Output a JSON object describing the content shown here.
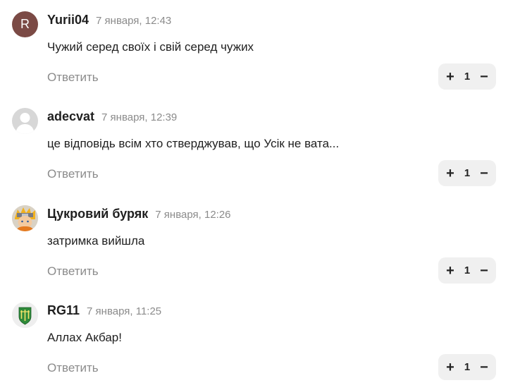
{
  "comments": [
    {
      "author": "Yurii04",
      "avatar_letter": "R",
      "avatar_color": "#7b4a45",
      "date": "7 января, 12:43",
      "text": "Чужий серед своїх і свій серед чужих",
      "reply_label": "Ответить",
      "vote_count": "1"
    },
    {
      "author": "adecvat",
      "avatar_icon": "default-user-icon",
      "date": "7 января, 12:39",
      "text": "це відповідь всім хто стверджував, що Усік не вата...",
      "reply_label": "Ответить",
      "vote_count": "1"
    },
    {
      "author": "Цукровий буряк",
      "avatar_icon": "anime-character-avatar",
      "date": "7 января, 12:26",
      "text": "затримка вийшла",
      "reply_label": "Ответить",
      "vote_count": "1"
    },
    {
      "author": "RG11",
      "avatar_icon": "green-emblem-avatar",
      "date": "7 января, 11:25",
      "text": "Аллах Акбар!",
      "reply_label": "Ответить",
      "vote_count": "1"
    }
  ],
  "vote_icons": {
    "upvote": "+",
    "downvote": "−"
  }
}
